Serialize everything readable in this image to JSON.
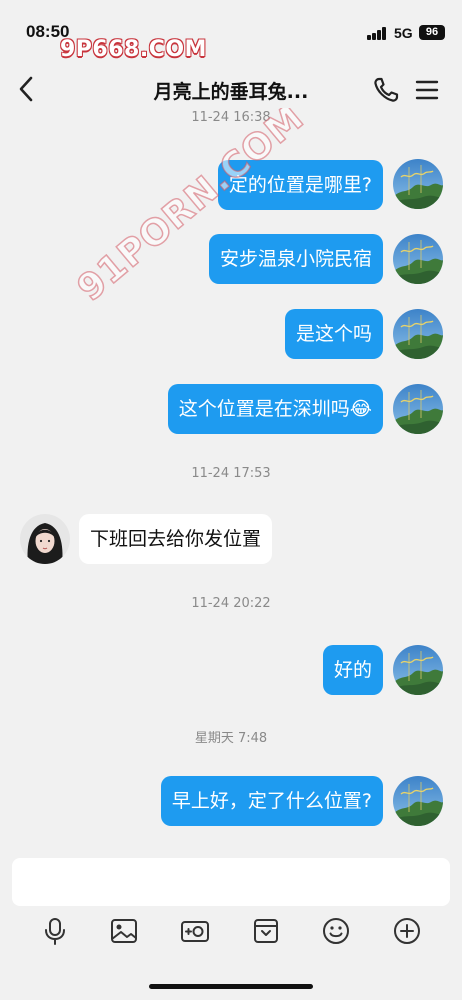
{
  "status_bar": {
    "time": "08:50",
    "watermark": "9P668.COM",
    "network": "5G",
    "battery": "96"
  },
  "nav": {
    "title": "月亮上的垂耳兔...",
    "back_icon": "chevron-left-icon",
    "call_icon": "phone-icon",
    "menu_icon": "menu-icon"
  },
  "watermark_diagonal": "91PORN.COM",
  "messages": [
    {
      "kind": "timestamp",
      "text": "11-24 16:38"
    },
    {
      "kind": "out",
      "text": "定的位置是哪里?"
    },
    {
      "kind": "out",
      "text": "安步温泉小院民宿"
    },
    {
      "kind": "out",
      "text": "是这个吗"
    },
    {
      "kind": "out",
      "text": "这个位置是在深圳吗😂"
    },
    {
      "kind": "timestamp",
      "text": "11-24 17:53"
    },
    {
      "kind": "in",
      "text": "下班回去给你发位置"
    },
    {
      "kind": "timestamp",
      "text": "11-24 20:22"
    },
    {
      "kind": "out",
      "text": "好的"
    },
    {
      "kind": "timestamp",
      "text": "星期天 7:48"
    },
    {
      "kind": "out",
      "text": "早上好，定了什么位置?"
    }
  ],
  "input": {
    "placeholder": "",
    "tools": [
      "microphone-icon",
      "image-icon",
      "camera-icon",
      "file-icon",
      "emoji-icon",
      "plus-icon"
    ]
  },
  "colors": {
    "outgoing_bubble": "#1e9bf0",
    "incoming_bubble": "#ffffff",
    "background": "#f1f1f1"
  }
}
